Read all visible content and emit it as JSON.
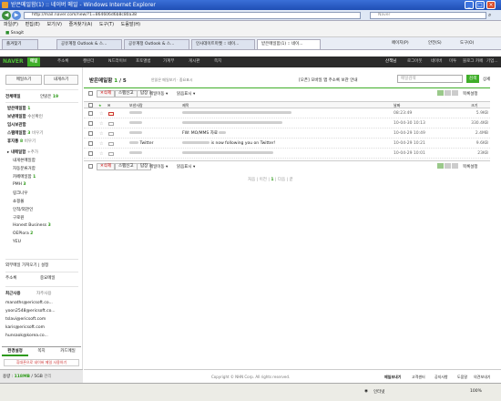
{
  "window": {
    "title": "받은메일함(1) :: 네이버 메일 - Windows Internet Explorer"
  },
  "address": {
    "url": "http://mail.naver.com/new/?1=864606d6b8c80a38",
    "search_placeholder": "Naver"
  },
  "menu": [
    "파일(F)",
    "편집(E)",
    "보기(V)",
    "즐겨찾기(A)",
    "도구(T)",
    "도움말(H)"
  ],
  "links": {
    "snagit": "Snagit"
  },
  "tabs": [
    {
      "label": "즐겨찾기"
    },
    {
      "label": "공유계정 Outlook & 스..."
    },
    {
      "label": "공유계정 Outlook & 스..."
    },
    {
      "label": "인사데이트마켓 :: 네이..."
    },
    {
      "label": "받은메일함(1) :: 네이..."
    }
  ],
  "ie_tools": {
    "page": "페이지(P)",
    "safety": "안전(S)",
    "tools": "도구(O)"
  },
  "gnb": {
    "logo": "NAVER",
    "items": [
      "메일",
      "주소록",
      "캘린더",
      "N드라이브",
      "포토앨범",
      "가계부",
      "게시판",
      "쪽지"
    ],
    "right": [
      "산책님",
      "로그아웃",
      "네이버",
      "미투",
      "블로그",
      "카페",
      "기업..."
    ]
  },
  "sidebar": {
    "write_btn": "메일쓰기",
    "self_btn": "내게쓰기",
    "all_mail": "전체메일",
    "unread_label": "안읽은",
    "unread_count": "19",
    "folders": [
      {
        "label": "받은메일함",
        "count": "1"
      },
      {
        "label": "보낸메일함",
        "count": "수신확인"
      },
      {
        "label": "임시보관함",
        "count": ""
      },
      {
        "label": "스팸메일함",
        "count": "3",
        "extra": "비우기"
      },
      {
        "label": "휴지통",
        "count": "8",
        "extra": "비우기"
      },
      {
        "label": "내메일함",
        "count": "",
        "extra": "+추가"
      },
      {
        "label": "내게쓴메일함",
        "count": ""
      },
      {
        "label": "자동분류거함",
        "count": ""
      },
      {
        "label": "카페메일함",
        "count": "1"
      },
      {
        "label": "PMH",
        "count": "3"
      },
      {
        "label": "링크나우",
        "count": ""
      },
      {
        "label": "쇼핑몰",
        "count": ""
      },
      {
        "label": "인척/외관인",
        "count": ""
      },
      {
        "label": "구로원",
        "count": ""
      },
      {
        "label": "Honest Business",
        "count": "3"
      },
      {
        "label": "OEPlora",
        "count": "2"
      },
      {
        "label": "YEU",
        "count": ""
      }
    ],
    "external": "외부메일 가져오기",
    "external_link": "설정",
    "addr_label": "주소록",
    "trans_label": "중요메일",
    "recent_title": "최근사용",
    "recent_link": "자주사용",
    "recent_list": [
      "manaths@ericsoft.co...",
      "yoon2548@ericsoft.co...",
      "tslavi@ericsoft.com",
      "karis@ericsoft.com",
      "hunsaok@korea.co..."
    ],
    "bottom_tabs": [
      "환경설정",
      "쪽지",
      "카드메일"
    ],
    "promo": "휴대폰으로 네이버 메일 사용하기"
  },
  "main": {
    "folder_title": "받은메일함",
    "unread_count": "1",
    "total_count": "5",
    "tags": [
      "안읽은 메일보기",
      "중요표시"
    ],
    "search_hint": "[오픈] 모바일 앱 주소록 보관 안내",
    "search_placeholder": "메일검색",
    "search_btn": "검색",
    "search_detail": "상세",
    "toolbar": [
      "삭제",
      "스팸신고",
      "답장",
      "메일이동",
      "읽음표시"
    ],
    "settings": "목록설정",
    "columns": {
      "sender": "보낸사람",
      "subject": "제목",
      "date": "날짜",
      "size": "크기"
    },
    "rows": [
      {
        "sender": "",
        "subject": "",
        "date": "08:23:49",
        "size": "5.9KB"
      },
      {
        "sender": "",
        "subject": "",
        "date": "10-04-30 10:13",
        "size": "330.4KB"
      },
      {
        "sender": "",
        "subject": "FW: MO/MMS 자료",
        "date": "10-04-29 10:49",
        "size": "2.4MB"
      },
      {
        "sender": "Twitter",
        "subject": "is now following you on Twitter!",
        "date": "10-04-29 10:21",
        "size": "9.6KB"
      },
      {
        "sender": "",
        "subject": "",
        "date": "10-04-29 10:01",
        "size": "23KB"
      }
    ],
    "pagination": {
      "prev": "이전",
      "first": "처음",
      "current": "1",
      "next": "다음",
      "last": "끝"
    }
  },
  "footer": {
    "copyright": "Copyright © NHN Corp. All rights reserved.",
    "links": [
      "메일보내기",
      "고객센터",
      "공지사항",
      "도움말",
      "의견보내기"
    ]
  },
  "sidebar_bottom": {
    "used": "용량 :",
    "used_val": "118MB",
    "total": "5GB",
    "link": "관리"
  },
  "status": {
    "zone": "인터넷",
    "zoom": "100%"
  }
}
